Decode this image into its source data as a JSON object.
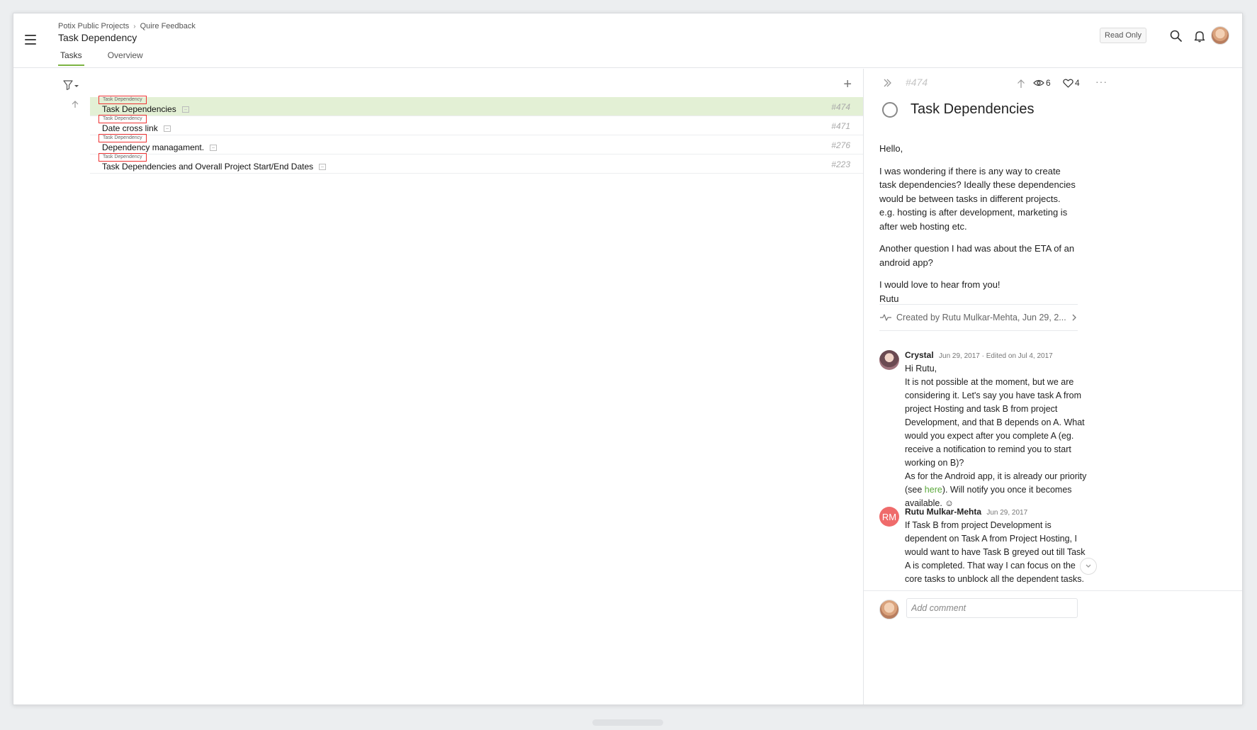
{
  "header": {
    "breadcrumb": [
      "Potix Public Projects",
      "Quire Feedback"
    ],
    "title": "Task Dependency",
    "tabs": [
      {
        "label": "Tasks",
        "active": true
      },
      {
        "label": "Overview",
        "active": false
      }
    ],
    "read_only_label": "Read Only",
    "icons": [
      "menu-icon",
      "search-icon",
      "bell-icon",
      "avatar"
    ]
  },
  "tasks": [
    {
      "tag": "Task Dependency",
      "name": "Task Dependencies",
      "id": "#474",
      "selected": true
    },
    {
      "tag": "Task Dependency",
      "name": "Date cross link",
      "id": "#471",
      "selected": false
    },
    {
      "tag": "Task Dependency",
      "name": "Dependency managament.",
      "id": "#276",
      "selected": false
    },
    {
      "tag": "Task Dependency",
      "name": "Task Dependencies and Overall Project Start/End Dates",
      "id": "#223",
      "selected": false
    }
  ],
  "detail": {
    "id": "#474",
    "watchers": "6",
    "likes": "4",
    "title": "Task Dependencies",
    "description": [
      "Hello,",
      "I was wondering if there is any way to create task dependencies? Ideally these dependencies would be between tasks in different projects. e.g. hosting is after development, marketing is after web hosting etc.",
      "Another question I had was about the ETA of an android app?",
      "I would love to hear from you!\nRutu"
    ],
    "created": "Created by Rutu Mulkar-Mehta, Jun 29, 2...",
    "comments": [
      {
        "author": "Crystal",
        "meta": "Jun 29, 2017 · Edited on Jul 4, 2017",
        "text_before": "Hi Rutu,\nIt is not possible at the moment, but we are considering it. Let's say you have task A from project Hosting and task B from project Development, and that B depends on A. What would you expect after you complete A (eg. receive a notification to remind you to start working on B)?\nAs for the Android app, it is already our priority (see ",
        "link": "here",
        "text_after": "). Will notify you once it becomes available. ☺"
      },
      {
        "author": "Rutu Mulkar-Mehta",
        "initials": "RM",
        "meta": "Jun 29, 2017",
        "text": "If Task B from project Development is dependent on Task A from Project Hosting, I would want to have Task B greyed out till Task A is completed. That way I can focus on the core tasks to unblock all the dependent tasks."
      }
    ],
    "comment_placeholder": "Add comment"
  },
  "colors": {
    "accent": "#7cb342",
    "selected_row": "#e3f0d5",
    "tag_border": "#ee3333",
    "link": "#5aa83a",
    "rm_avatar": "#ef6b6b"
  }
}
